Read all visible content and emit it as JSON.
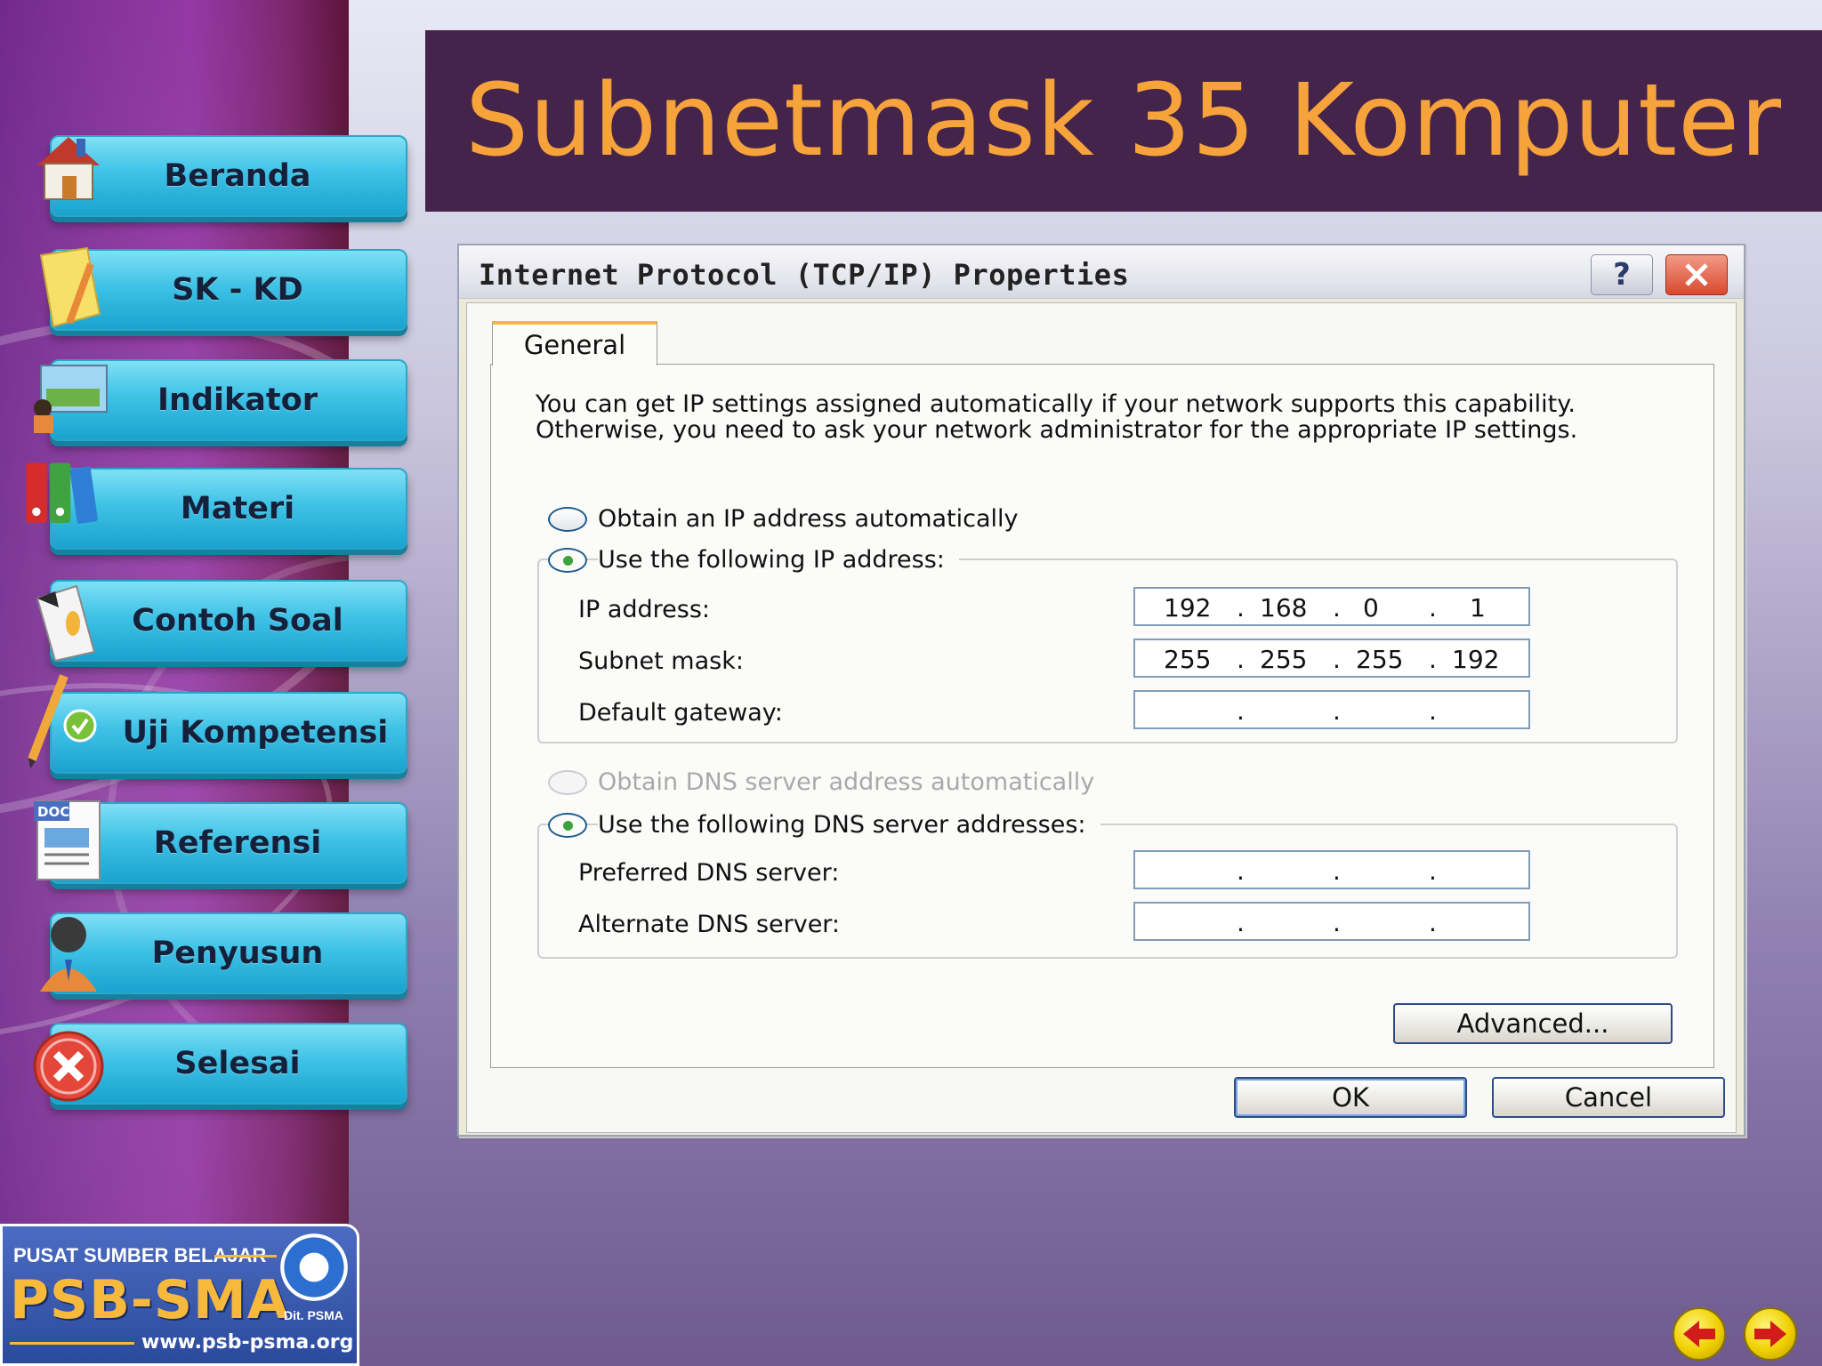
{
  "title": "Subnetmask 35 Komputer",
  "nav": {
    "items": [
      {
        "label": "Beranda",
        "icon": "home-icon"
      },
      {
        "label": "SK - KD",
        "icon": "notepad-icon"
      },
      {
        "label": "Indikator",
        "icon": "presentation-icon"
      },
      {
        "label": "Materi",
        "icon": "binders-icon"
      },
      {
        "label": "Contoh Soal",
        "icon": "document-pen-icon"
      },
      {
        "label": "Uji Kompetensi",
        "icon": "pencil-check-icon"
      },
      {
        "label": "Referensi",
        "icon": "doc-icon"
      },
      {
        "label": "Penyusun",
        "icon": "person-icon"
      },
      {
        "label": "Selesai",
        "icon": "close-icon"
      }
    ]
  },
  "dialog": {
    "title": "Internet Protocol (TCP/IP) Properties",
    "help_label": "?",
    "tab": "General",
    "description": "You can get IP settings assigned automatically if your network supports this capability. Otherwise, you need to ask your network administrator for the appropriate IP settings.",
    "ip_radio_auto": "Obtain an IP address automatically",
    "ip_radio_manual": "Use the following IP address:",
    "ip_label": "IP address:",
    "ip_value": [
      "192",
      "168",
      "0",
      "1"
    ],
    "mask_label": "Subnet mask:",
    "mask_value": [
      "255",
      "255",
      "255",
      "192"
    ],
    "gateway_label": "Default gateway:",
    "dns_radio_auto": "Obtain DNS server address automatically",
    "dns_radio_manual": "Use the following DNS server addresses:",
    "preferred_label": "Preferred DNS server:",
    "alternate_label": "Alternate DNS server:",
    "advanced_button": "Advanced...",
    "ok_button": "OK",
    "cancel_button": "Cancel",
    "selected_ip_option": "manual",
    "selected_dns_option": "manual"
  },
  "logo": {
    "line1": "PUSAT SUMBER BELAJAR",
    "line2": "PSB-SMA",
    "url": "www.psb-psma.org",
    "badge": "Dit. PSMA"
  },
  "colors": {
    "title_text": "#f7a33c",
    "title_band": "#44244a",
    "nav_button": "#3fc2e6"
  }
}
